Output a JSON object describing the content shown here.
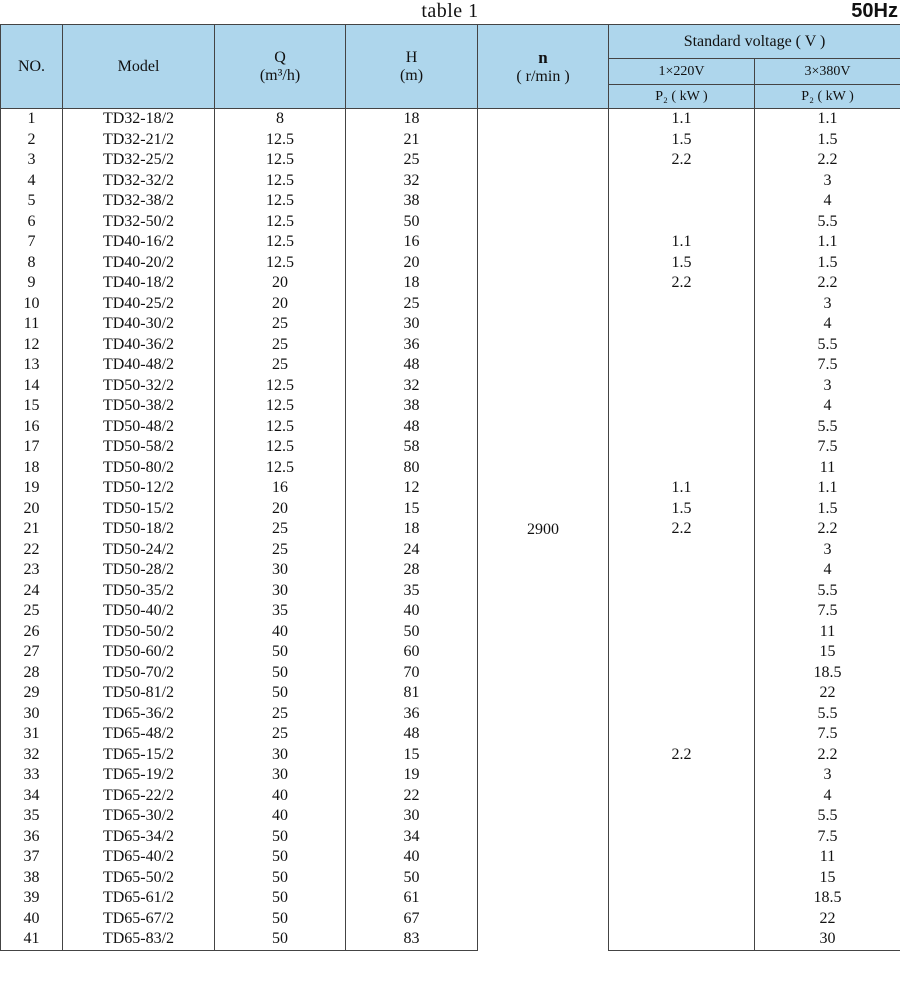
{
  "caption": {
    "title": "table 1",
    "frequency": "50Hz"
  },
  "headers": {
    "no": "NO.",
    "model": "Model",
    "q_name": "Q",
    "q_unit": "(m³/h)",
    "h_name": "H",
    "h_unit": "(m)",
    "n_name": "n",
    "n_unit": "( r/min )",
    "voltage_group": "Standard voltage ( V )",
    "single_phase": "1×220V",
    "three_phase": "3×380V",
    "p2_single": "P₂ ( kW )",
    "p2_three": "P₂ ( kW )"
  },
  "speed": "2900",
  "rows": [
    {
      "no": "1",
      "model": "TD32-18/2",
      "q": "8",
      "h": "18",
      "p1": "1.1",
      "p3": "1.1"
    },
    {
      "no": "2",
      "model": "TD32-21/2",
      "q": "12.5",
      "h": "21",
      "p1": "1.5",
      "p3": "1.5"
    },
    {
      "no": "3",
      "model": "TD32-25/2",
      "q": "12.5",
      "h": "25",
      "p1": "2.2",
      "p3": "2.2"
    },
    {
      "no": "4",
      "model": "TD32-32/2",
      "q": "12.5",
      "h": "32",
      "p1": "",
      "p3": "3"
    },
    {
      "no": "5",
      "model": "TD32-38/2",
      "q": "12.5",
      "h": "38",
      "p1": "",
      "p3": "4"
    },
    {
      "no": "6",
      "model": "TD32-50/2",
      "q": "12.5",
      "h": "50",
      "p1": "",
      "p3": "5.5"
    },
    {
      "no": "7",
      "model": "TD40-16/2",
      "q": "12.5",
      "h": "16",
      "p1": "1.1",
      "p3": "1.1"
    },
    {
      "no": "8",
      "model": "TD40-20/2",
      "q": "12.5",
      "h": "20",
      "p1": "1.5",
      "p3": "1.5"
    },
    {
      "no": "9",
      "model": "TD40-18/2",
      "q": "20",
      "h": "18",
      "p1": "2.2",
      "p3": "2.2"
    },
    {
      "no": "10",
      "model": "TD40-25/2",
      "q": "20",
      "h": "25",
      "p1": "",
      "p3": "3"
    },
    {
      "no": "11",
      "model": "TD40-30/2",
      "q": "25",
      "h": "30",
      "p1": "",
      "p3": "4"
    },
    {
      "no": "12",
      "model": "TD40-36/2",
      "q": "25",
      "h": "36",
      "p1": "",
      "p3": "5.5"
    },
    {
      "no": "13",
      "model": "TD40-48/2",
      "q": "25",
      "h": "48",
      "p1": "",
      "p3": "7.5"
    },
    {
      "no": "14",
      "model": "TD50-32/2",
      "q": "12.5",
      "h": "32",
      "p1": "",
      "p3": "3"
    },
    {
      "no": "15",
      "model": "TD50-38/2",
      "q": "12.5",
      "h": "38",
      "p1": "",
      "p3": "4"
    },
    {
      "no": "16",
      "model": "TD50-48/2",
      "q": "12.5",
      "h": "48",
      "p1": "",
      "p3": "5.5"
    },
    {
      "no": "17",
      "model": "TD50-58/2",
      "q": "12.5",
      "h": "58",
      "p1": "",
      "p3": "7.5"
    },
    {
      "no": "18",
      "model": "TD50-80/2",
      "q": "12.5",
      "h": "80",
      "p1": "",
      "p3": "11"
    },
    {
      "no": "19",
      "model": "TD50-12/2",
      "q": "16",
      "h": "12",
      "p1": "1.1",
      "p3": "1.1"
    },
    {
      "no": "20",
      "model": "TD50-15/2",
      "q": "20",
      "h": "15",
      "p1": "1.5",
      "p3": "1.5"
    },
    {
      "no": "21",
      "model": "TD50-18/2",
      "q": "25",
      "h": "18",
      "p1": "2.2",
      "p3": "2.2"
    },
    {
      "no": "22",
      "model": "TD50-24/2",
      "q": "25",
      "h": "24",
      "p1": "",
      "p3": "3"
    },
    {
      "no": "23",
      "model": "TD50-28/2",
      "q": "30",
      "h": "28",
      "p1": "",
      "p3": "4"
    },
    {
      "no": "24",
      "model": "TD50-35/2",
      "q": "30",
      "h": "35",
      "p1": "",
      "p3": "5.5"
    },
    {
      "no": "25",
      "model": "TD50-40/2",
      "q": "35",
      "h": "40",
      "p1": "",
      "p3": "7.5"
    },
    {
      "no": "26",
      "model": "TD50-50/2",
      "q": "40",
      "h": "50",
      "p1": "",
      "p3": "11"
    },
    {
      "no": "27",
      "model": "TD50-60/2",
      "q": "50",
      "h": "60",
      "p1": "",
      "p3": "15"
    },
    {
      "no": "28",
      "model": "TD50-70/2",
      "q": "50",
      "h": "70",
      "p1": "",
      "p3": "18.5"
    },
    {
      "no": "29",
      "model": "TD50-81/2",
      "q": "50",
      "h": "81",
      "p1": "",
      "p3": "22"
    },
    {
      "no": "30",
      "model": "TD65-36/2",
      "q": "25",
      "h": "36",
      "p1": "",
      "p3": "5.5"
    },
    {
      "no": "31",
      "model": "TD65-48/2",
      "q": "25",
      "h": "48",
      "p1": "",
      "p3": "7.5"
    },
    {
      "no": "32",
      "model": "TD65-15/2",
      "q": "30",
      "h": "15",
      "p1": "2.2",
      "p3": "2.2"
    },
    {
      "no": "33",
      "model": "TD65-19/2",
      "q": "30",
      "h": "19",
      "p1": "",
      "p3": "3"
    },
    {
      "no": "34",
      "model": "TD65-22/2",
      "q": "40",
      "h": "22",
      "p1": "",
      "p3": "4"
    },
    {
      "no": "35",
      "model": "TD65-30/2",
      "q": "40",
      "h": "30",
      "p1": "",
      "p3": "5.5"
    },
    {
      "no": "36",
      "model": "TD65-34/2",
      "q": "50",
      "h": "34",
      "p1": "",
      "p3": "7.5"
    },
    {
      "no": "37",
      "model": "TD65-40/2",
      "q": "50",
      "h": "40",
      "p1": "",
      "p3": "11"
    },
    {
      "no": "38",
      "model": "TD65-50/2",
      "q": "50",
      "h": "50",
      "p1": "",
      "p3": "15"
    },
    {
      "no": "39",
      "model": "TD65-61/2",
      "q": "50",
      "h": "61",
      "p1": "",
      "p3": "18.5"
    },
    {
      "no": "40",
      "model": "TD65-67/2",
      "q": "50",
      "h": "67",
      "p1": "",
      "p3": "22"
    },
    {
      "no": "41",
      "model": "TD65-83/2",
      "q": "50",
      "h": "83",
      "p1": "",
      "p3": "30"
    }
  ]
}
